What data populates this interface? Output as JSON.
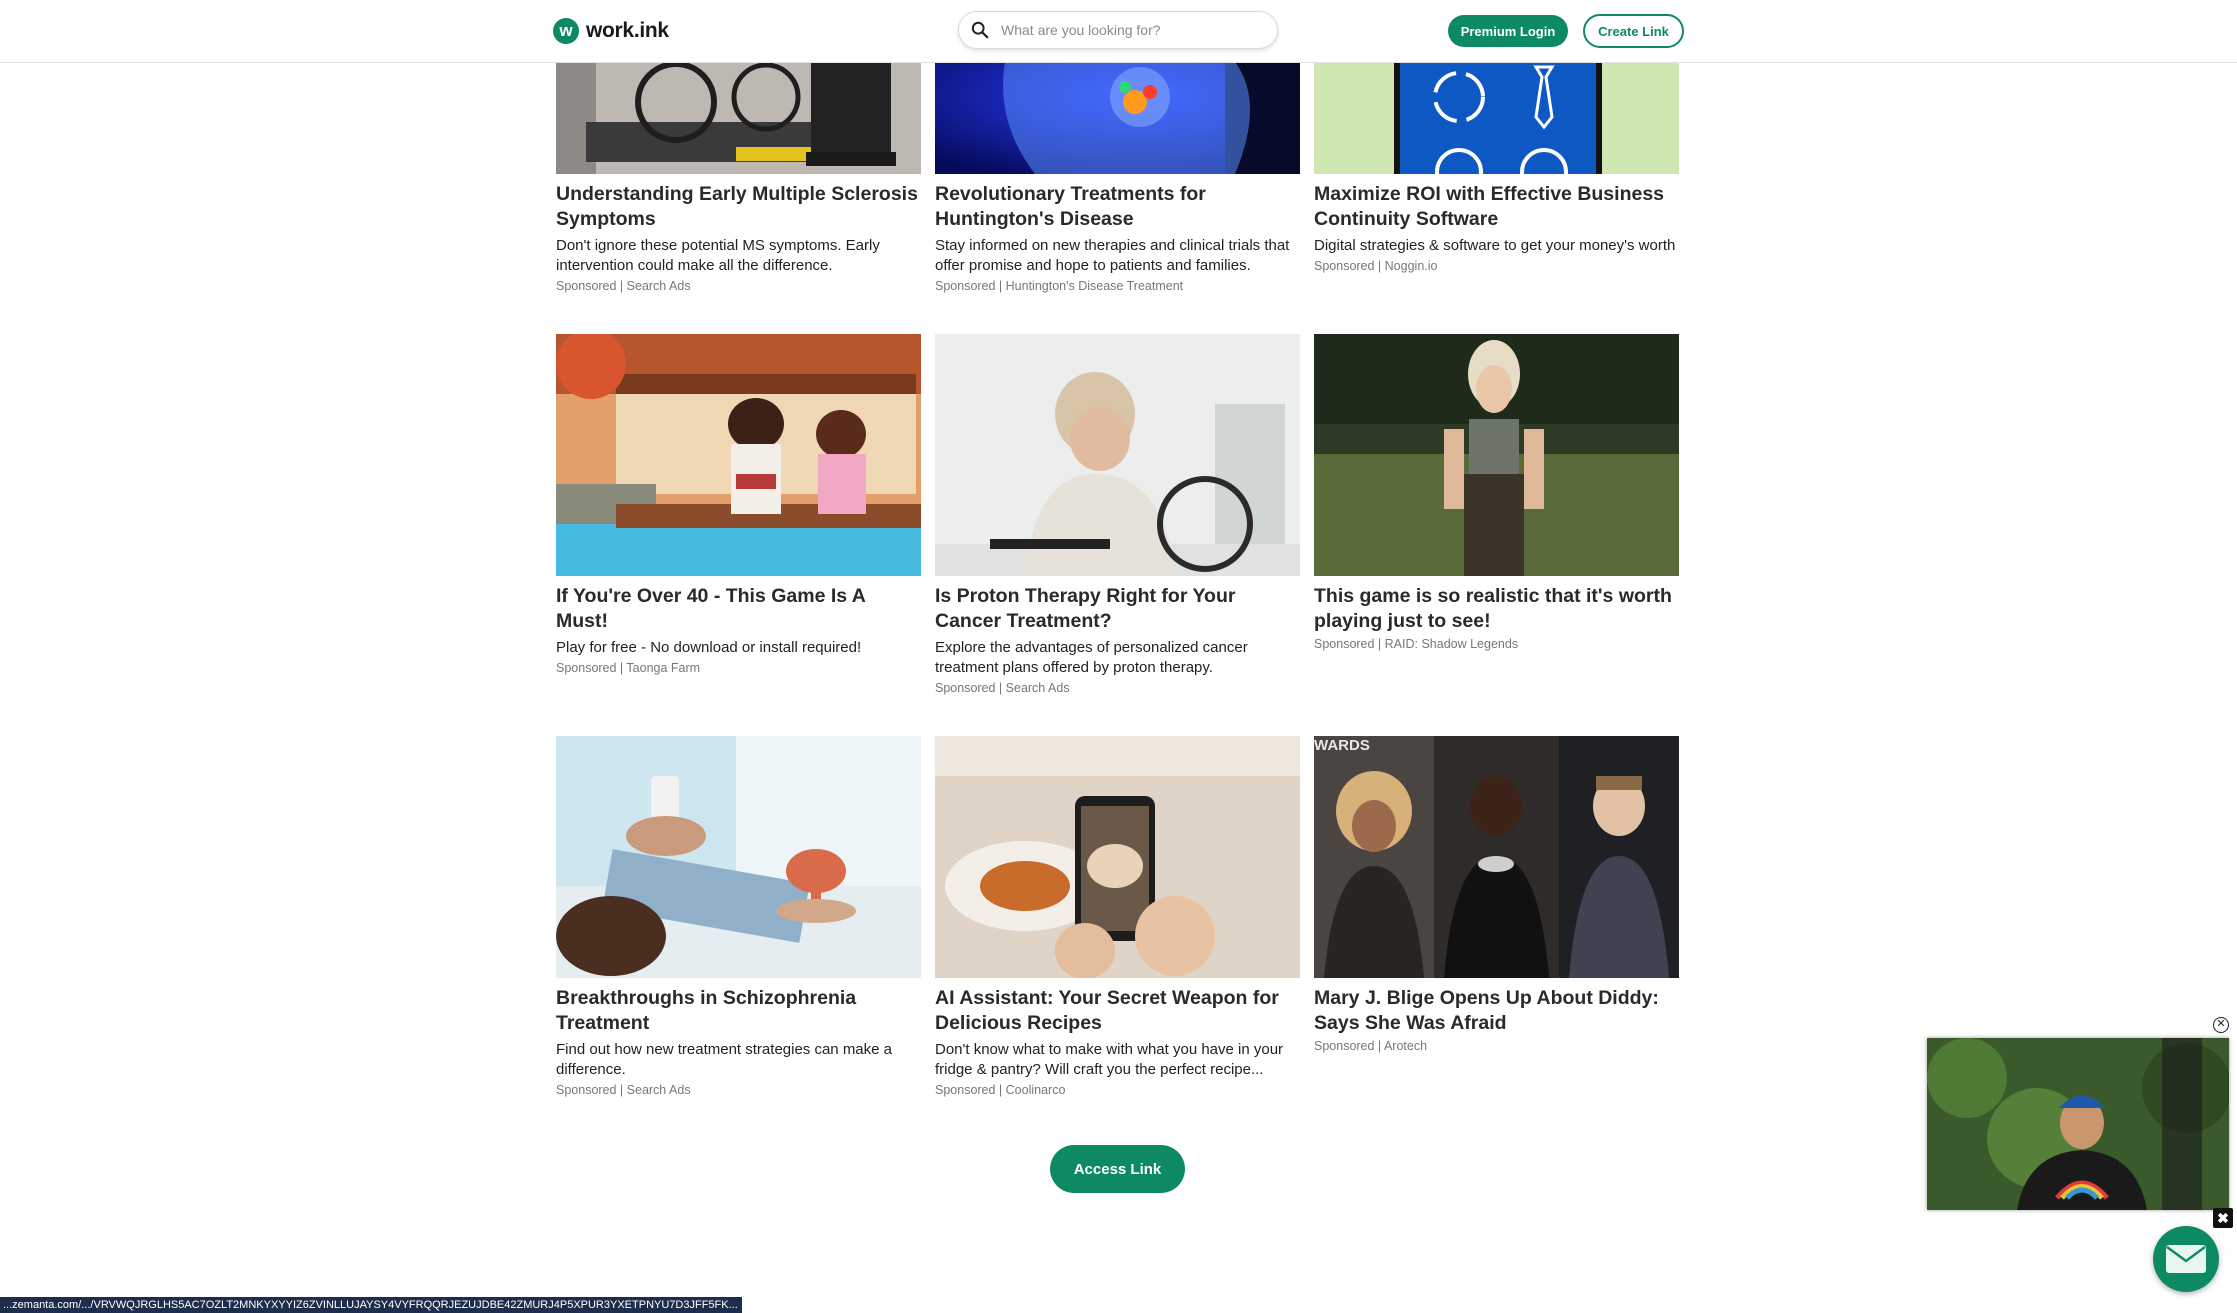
{
  "header": {
    "logo_letter": "w",
    "logo_text": "work.ink",
    "search_placeholder": "What are you looking for?",
    "premium_login": "Premium Login",
    "create_link": "Create Link"
  },
  "cards": [
    {
      "title": "Understanding Early Multiple Sclerosis Symptoms",
      "desc": "Don't ignore these potential MS symptoms. Early intervention could make all the difference.",
      "sponsor": "Sponsored | Search Ads"
    },
    {
      "title": "Revolutionary Treatments for Huntington's Disease",
      "desc": "Stay informed on new therapies and clinical trials that offer promise and hope to patients and families.",
      "sponsor": "Sponsored | Huntington's Disease Treatment"
    },
    {
      "title": "Maximize ROI with Effective Business Continuity Software",
      "desc": "Digital strategies & software to get your money's worth",
      "sponsor": "Sponsored | Noggin.io"
    },
    {
      "title": "If You're Over 40 - This Game Is A Must!",
      "desc": "Play for free - No download or install required!",
      "sponsor": "Sponsored | Taonga Farm"
    },
    {
      "title": "Is Proton Therapy Right for Your Cancer Treatment?",
      "desc": "Explore the advantages of personalized cancer treatment plans offered by proton therapy.",
      "sponsor": "Sponsored | Search Ads"
    },
    {
      "title": "This game is so realistic that it's worth playing just to see!",
      "desc": "",
      "sponsor": "Sponsored | RAID: Shadow Legends"
    },
    {
      "title": "Breakthroughs in Schizophrenia Treatment",
      "desc": "Find out how new treatment strategies can make a difference.",
      "sponsor": "Sponsored | Search Ads"
    },
    {
      "title": "AI Assistant: Your Secret Weapon for Delicious Recipes",
      "desc": "Don't know what to make with what you have in your fridge & pantry? Will craft you the perfect recipe...",
      "sponsor": "Sponsored | Coolinarco"
    },
    {
      "title": "Mary J. Blige Opens Up About Diddy: Says She Was Afraid",
      "desc": "",
      "sponsor": "Sponsored | Arotech"
    }
  ],
  "overlays": {
    "awards_text": "WARDS"
  },
  "access_link": "Access Link",
  "video": {
    "close_symbol": "✕",
    "x_symbol": "✖"
  },
  "status_url": "...zemanta.com/.../VRVWQJRGLHS5AC7OZLT2MNKYXYYIZ6ZVINLLUJAYSY4VYFRQQRJEZUJDBE42ZMURJ4P5XPUR3YXETPNYU7D3JFF5FK..."
}
